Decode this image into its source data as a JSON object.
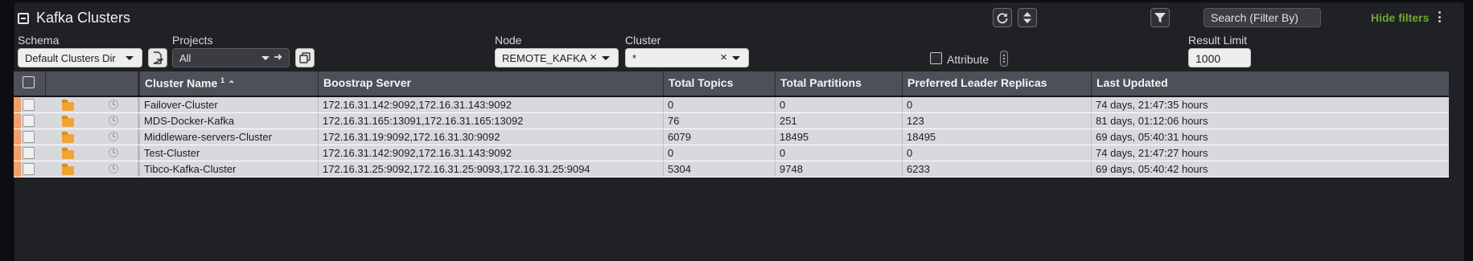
{
  "panel": {
    "title": "Kafka Clusters"
  },
  "toolbar": {
    "search_placeholder": "Search (Filter By)",
    "hide_filters_label": "Hide filters"
  },
  "filters": {
    "schema": {
      "label": "Schema",
      "value": "Default Clusters Dir"
    },
    "projects": {
      "label": "Projects",
      "value": "All"
    },
    "node": {
      "label": "Node",
      "value": "REMOTE_KAFKA"
    },
    "cluster": {
      "label": "Cluster",
      "value": "*"
    },
    "attribute": {
      "label": "Attribute"
    },
    "result_limit": {
      "label": "Result Limit",
      "value": "1000"
    }
  },
  "table": {
    "sort_superscript": "1",
    "columns": [
      "Cluster Name",
      "Boostrap Server",
      "Total Topics",
      "Total Partitions",
      "Preferred Leader Replicas",
      "Last Updated"
    ],
    "rows": [
      [
        "Failover-Cluster",
        "172.16.31.142:9092,172.16.31.143:9092",
        "0",
        "0",
        "0",
        "74 days, 21:47:35 hours"
      ],
      [
        "MDS-Docker-Kafka",
        "172.16.31.165:13091,172.16.31.165:13092",
        "76",
        "251",
        "123",
        "81 days, 01:12:06 hours"
      ],
      [
        "Middleware-servers-Cluster",
        "172.16.31.19:9092,172.16.31.30:9092",
        "6079",
        "18495",
        "18495",
        "69 days, 05:40:31 hours"
      ],
      [
        "Test-Cluster",
        "172.16.31.142:9092,172.16.31.143:9092",
        "0",
        "0",
        "0",
        "74 days, 21:47:27 hours"
      ],
      [
        "Tibco-Kafka-Cluster",
        "172.16.31.25:9092,172.16.31.25:9093,172.16.31.25:9094",
        "5304",
        "9748",
        "6233",
        "69 days, 05:40:42 hours"
      ]
    ]
  },
  "colors": {
    "accent_green": "#6ea832",
    "row_marker": "#f0a068",
    "folder": "#f1a531",
    "header_bg": "#4d5058",
    "row_bg": "#d7d9de"
  },
  "icons": {
    "collapse": "minus-square-icon",
    "refresh": "refresh-icon",
    "sort": "sort-updown-icon",
    "filter": "funnel-icon",
    "menu": "kebab-menu-icon",
    "export": "export-document-icon",
    "copy": "copy-icon",
    "folder": "folder-icon",
    "history": "clock-icon"
  }
}
